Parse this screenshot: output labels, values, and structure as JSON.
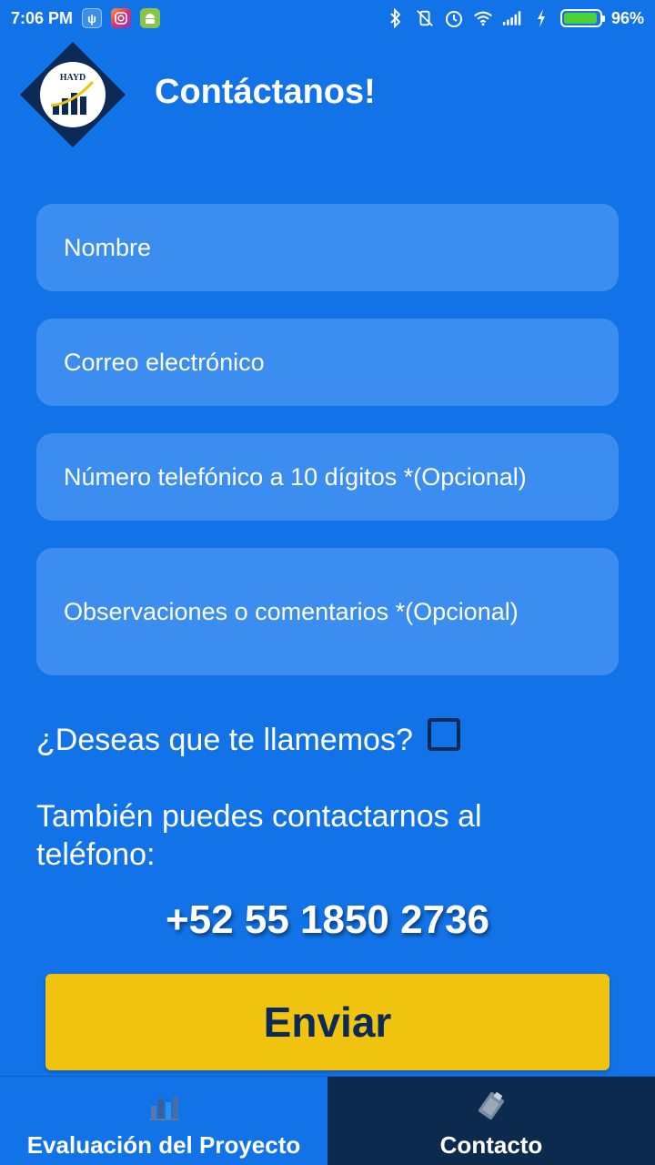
{
  "status_bar": {
    "time": "7:06 PM",
    "battery_percent": "96%",
    "battery_level": 0.96
  },
  "header": {
    "title": "Contáctanos!",
    "logo_text": "HAYD"
  },
  "form": {
    "name_placeholder": "Nombre",
    "email_placeholder": "Correo electrónico",
    "phone_placeholder": "Número telefónico a 10 dígitos  *(Opcional)",
    "comments_placeholder": "Observaciones o comentarios  *(Opcional)",
    "call_question": "¿Deseas que te llamemos?",
    "call_checked": false
  },
  "contact": {
    "also_text": "También puedes contactarnos al teléfono:",
    "phone": "+52 55 1850 2736"
  },
  "send_label": "Enviar",
  "nav": {
    "items": [
      {
        "label": "Evaluación del Proyecto",
        "icon": "bar-chart-icon",
        "active": false
      },
      {
        "label": "Contacto",
        "icon": "clipboard-icon",
        "active": true
      }
    ]
  },
  "colors": {
    "background": "#1273e8",
    "field": "#3b8df0",
    "button": "#f0c30f",
    "dark": "#0b2a4e"
  }
}
